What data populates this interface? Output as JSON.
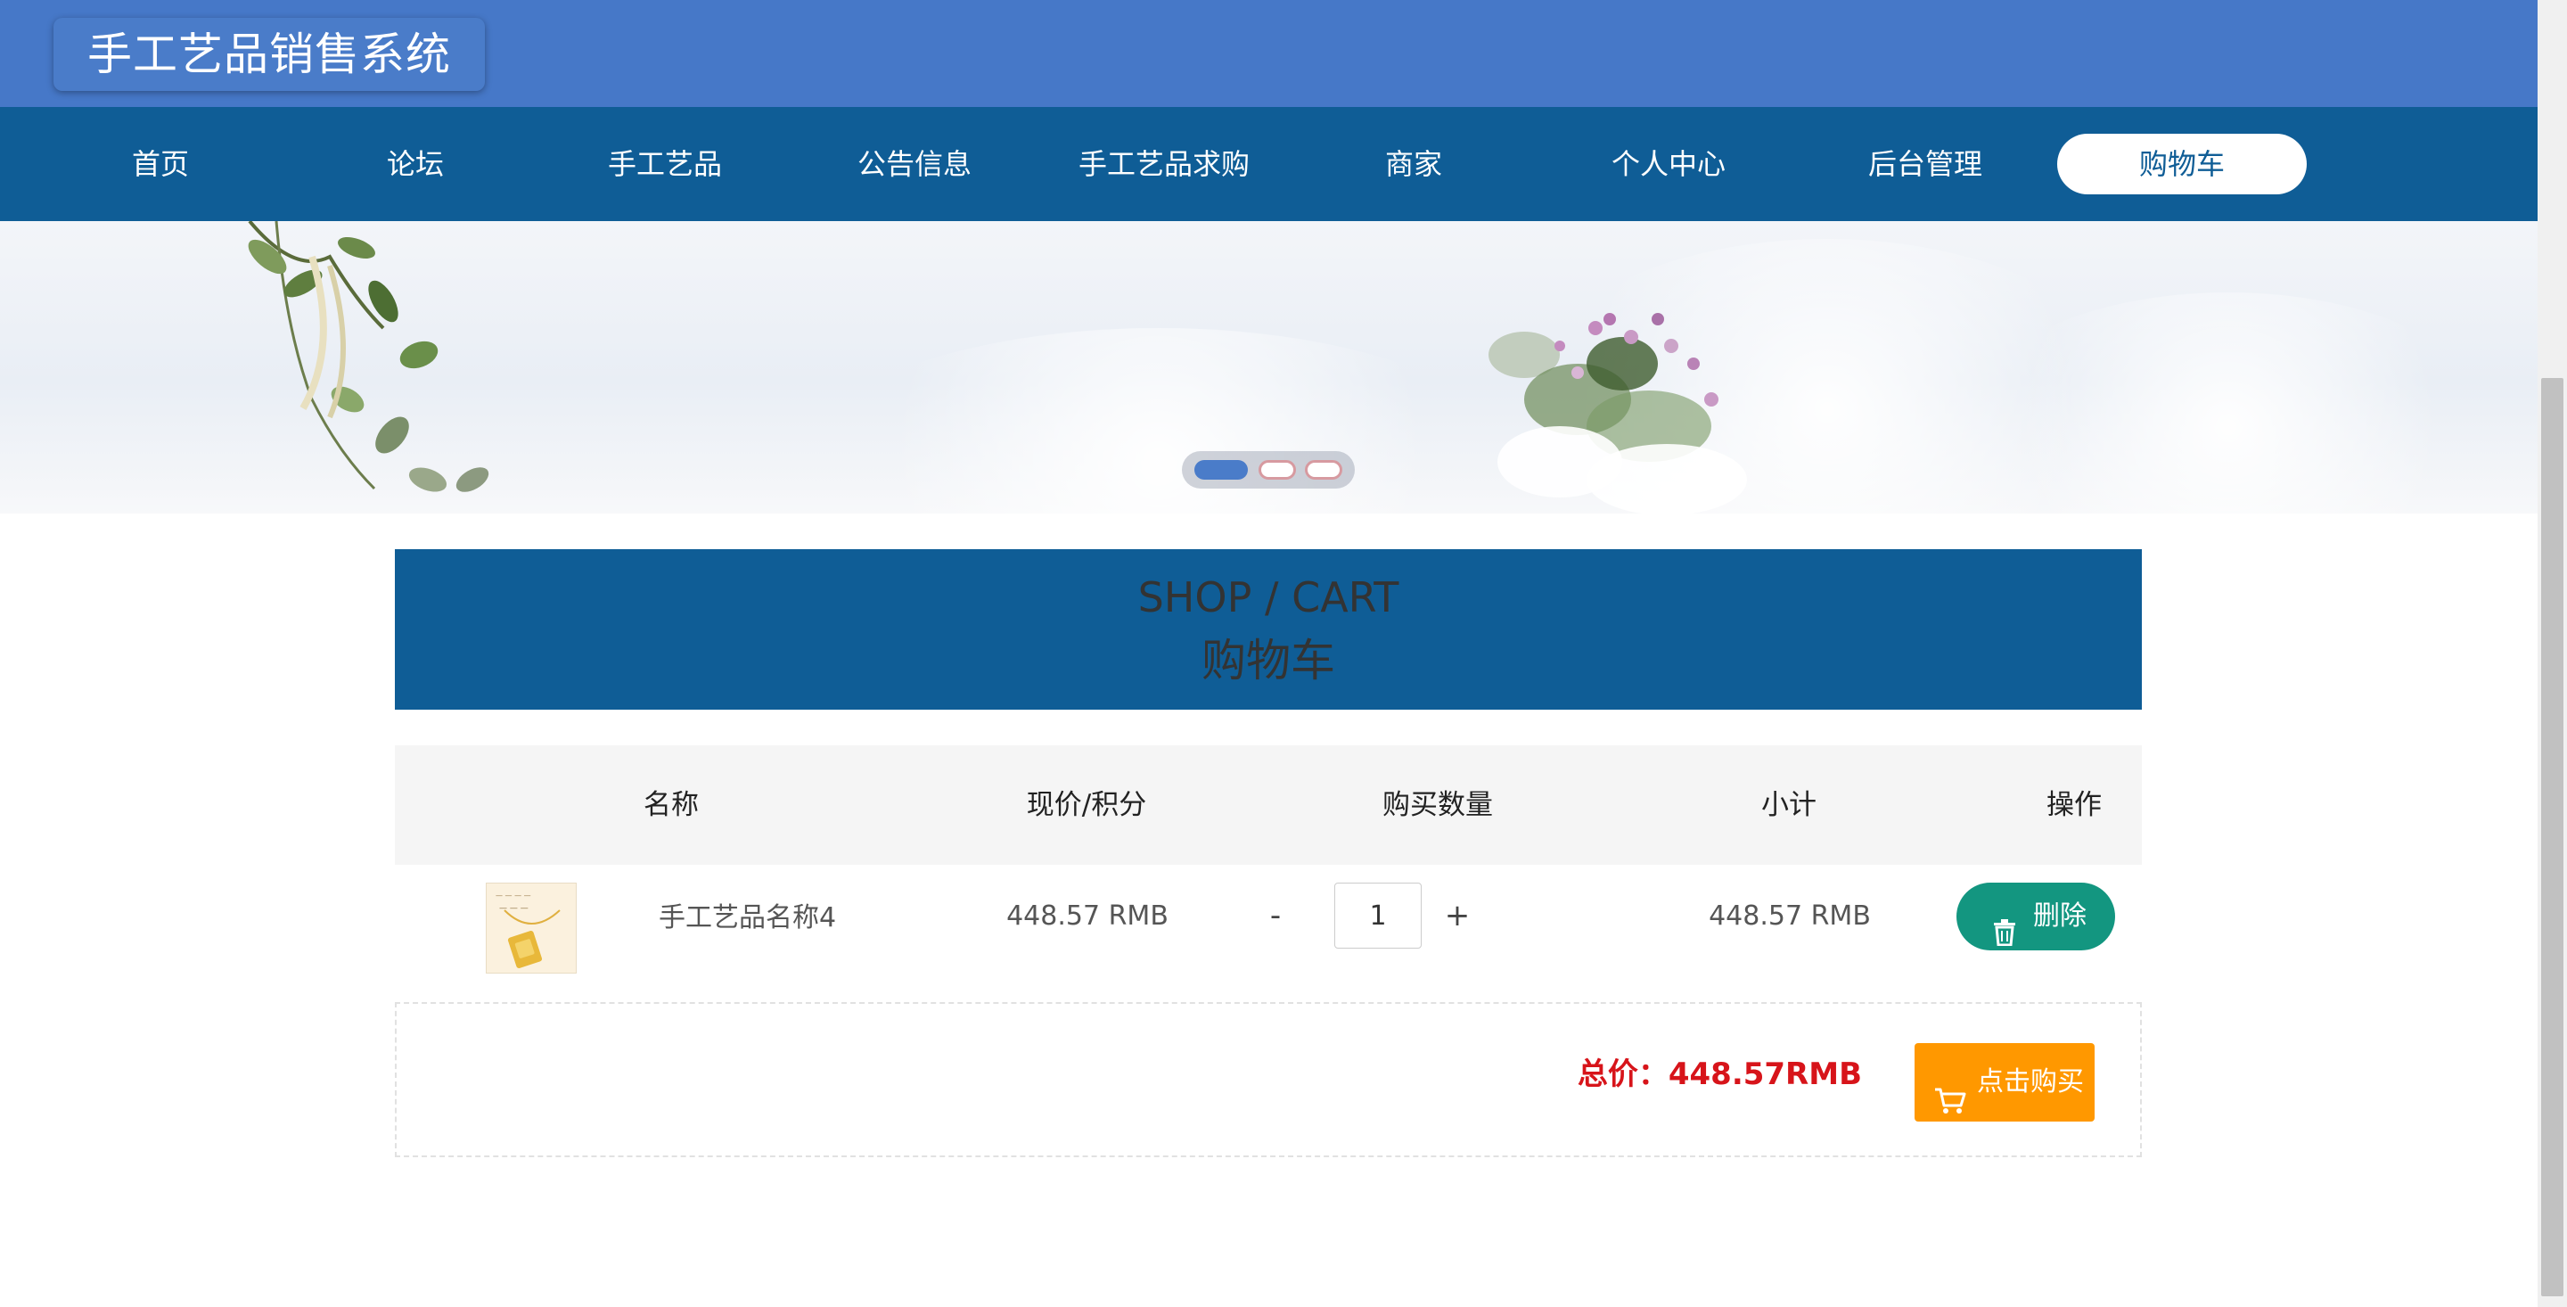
{
  "site": {
    "title": "手工艺品销售系统"
  },
  "nav": {
    "items": [
      {
        "label": "首页"
      },
      {
        "label": "论坛"
      },
      {
        "label": "手工艺品"
      },
      {
        "label": "公告信息"
      },
      {
        "label": "手工艺品求购"
      },
      {
        "label": "商家"
      },
      {
        "label": "个人中心"
      },
      {
        "label": "后台管理"
      },
      {
        "label": "购物车",
        "active": true
      }
    ]
  },
  "banner": {
    "slides": 3,
    "active_slide": 1
  },
  "cart_header": {
    "title_en": "SHOP / CART",
    "title_cn": "购物车"
  },
  "table": {
    "columns": [
      "名称",
      "现价/积分",
      "购买数量",
      "小计",
      "操作"
    ],
    "rows": [
      {
        "image_icon": "product-thumbnail",
        "name": "手工艺品名称4",
        "price": "448.57 RMB",
        "decrement": "-",
        "quantity": "1",
        "increment": "+",
        "subtotal": "448.57 RMB",
        "delete_label": "删除",
        "delete_icon": "trash-icon"
      }
    ]
  },
  "summary": {
    "total": "总价：448.57RMB",
    "buy_label": "点击购买",
    "buy_icon": "cart-icon"
  },
  "colors": {
    "topbar": "#4678c8",
    "navbar": "#0f5d96",
    "delete_button": "#139680",
    "buy_button": "#ff9800",
    "total_text": "#d7141a"
  }
}
